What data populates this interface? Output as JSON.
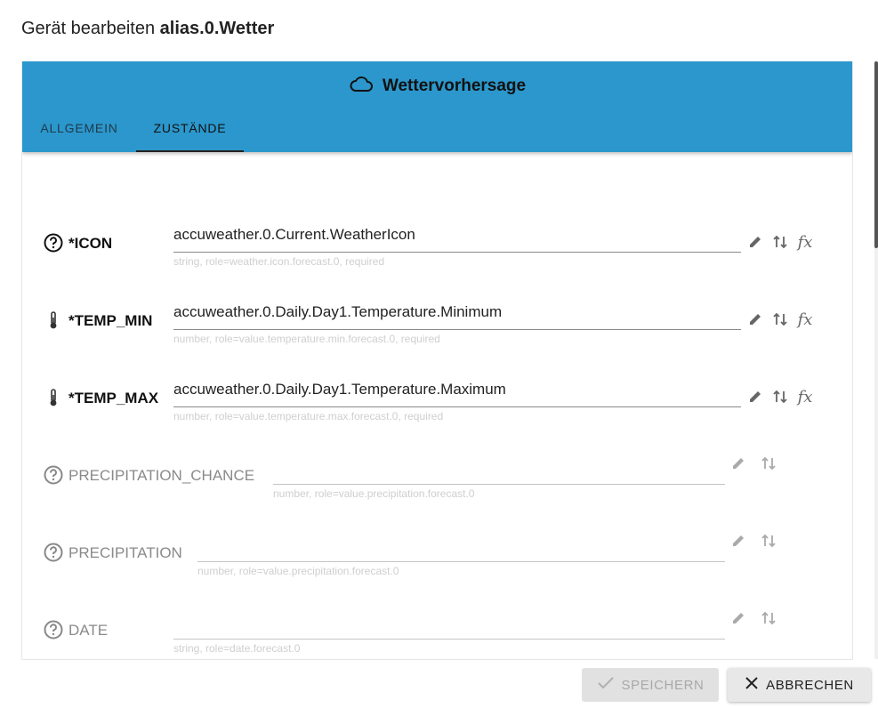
{
  "dialog": {
    "title_prefix": "Gerät bearbeiten",
    "title_id": "alias.0.Wetter"
  },
  "header": {
    "icon": "cloud-icon",
    "title": "Wettervorhersage",
    "tabs": [
      {
        "label": "ALLGEMEIN",
        "active": false
      },
      {
        "label": "ZUSTÄNDE",
        "active": true
      }
    ],
    "color": "#2b97cc"
  },
  "states": [
    {
      "name": "*ICON",
      "icon": "help-circle-icon",
      "required": true,
      "value": "accuweather.0.Current.WeatherIcon",
      "helper": "string, role=weather.icon.forecast.0, required",
      "has_fx": true
    },
    {
      "name": "*TEMP_MIN",
      "icon": "thermometer-icon",
      "required": true,
      "value": "accuweather.0.Daily.Day1.Temperature.Minimum",
      "helper": "number, role=value.temperature.min.forecast.0, required",
      "has_fx": true
    },
    {
      "name": "*TEMP_MAX",
      "icon": "thermometer-icon",
      "required": true,
      "value": "accuweather.0.Daily.Day1.Temperature.Maximum",
      "helper": "number, role=value.temperature.max.forecast.0, required",
      "has_fx": true
    },
    {
      "name": "PRECIPITATION_CHANCE",
      "icon": "help-circle-icon",
      "required": false,
      "value": "",
      "helper": "number, role=value.precipitation.forecast.0",
      "has_fx": false
    },
    {
      "name": "PRECIPITATION",
      "icon": "help-circle-icon",
      "required": false,
      "value": "",
      "helper": "number, role=value.precipitation.forecast.0",
      "has_fx": false
    },
    {
      "name": "DATE",
      "icon": "help-circle-icon",
      "required": false,
      "value": "",
      "helper": "string, role=date.forecast.0",
      "has_fx": false
    }
  ],
  "buttons": {
    "save": "SPEICHERN",
    "cancel": "ABBRECHEN"
  }
}
